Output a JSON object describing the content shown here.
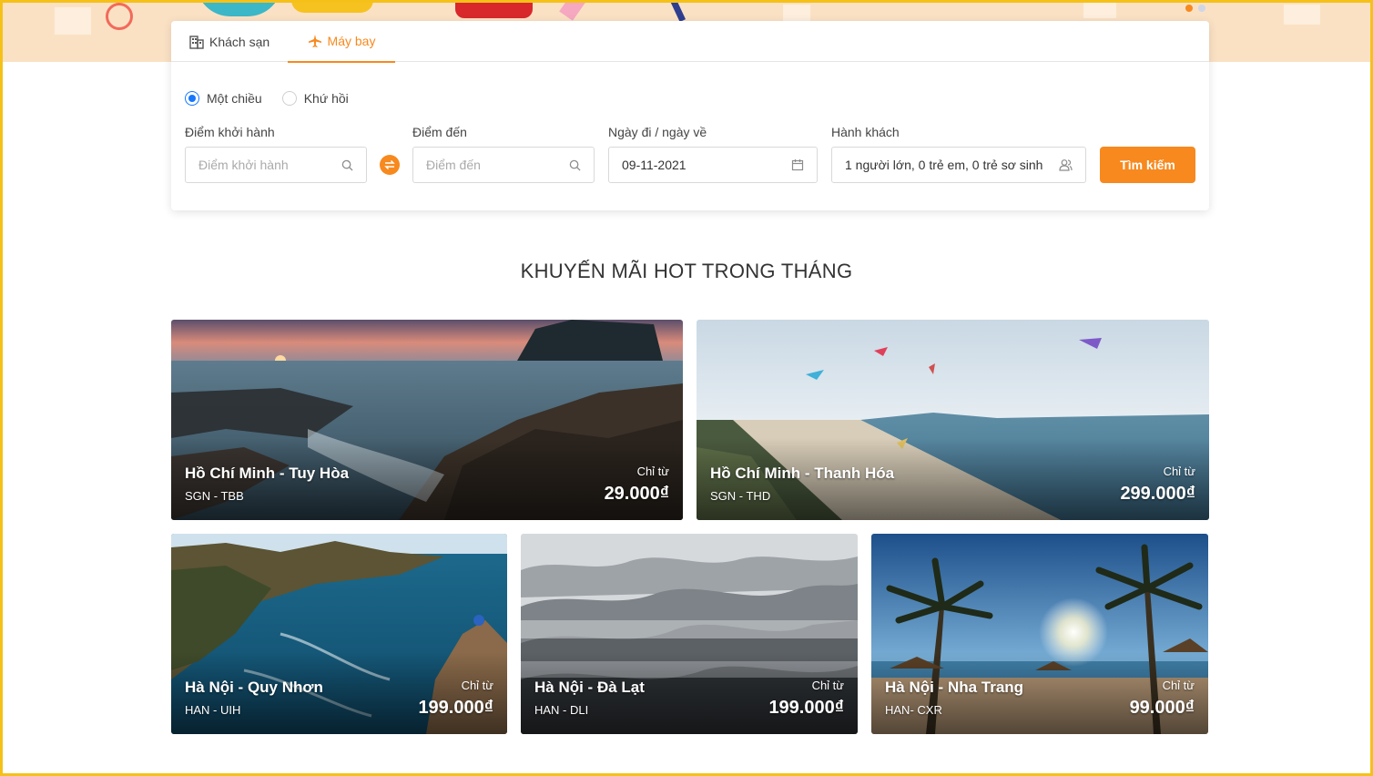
{
  "tabs": [
    {
      "label": "Khách sạn",
      "icon": "building-icon"
    },
    {
      "label": "Máy bay",
      "icon": "plane-icon",
      "active": true
    }
  ],
  "trip_type": {
    "options": [
      "Một chiều",
      "Khứ hồi"
    ],
    "selected": "Một chiều"
  },
  "search": {
    "origin": {
      "label": "Điểm khởi hành",
      "placeholder": "Điểm khởi hành",
      "value": ""
    },
    "destination": {
      "label": "Điểm đến",
      "placeholder": "Điểm đến",
      "value": ""
    },
    "dates": {
      "label": "Ngày đi / ngày về",
      "value": "09-11-2021"
    },
    "passengers": {
      "label": "Hành khách",
      "value": "1 người lớn, 0 trẻ em, 0 trẻ sơ sinh"
    },
    "button_label": "Tìm kiếm"
  },
  "promo": {
    "title": "KHUYẾN MÃI HOT TRONG THÁNG",
    "cards": [
      {
        "route": "Hồ Chí Minh - Tuy Hòa",
        "code": "SGN - TBB",
        "from_label": "Chỉ từ",
        "price": "29.000₫"
      },
      {
        "route": "Hồ Chí Minh - Thanh Hóa",
        "code": "SGN - THD",
        "from_label": "Chỉ từ",
        "price": "299.000₫"
      },
      {
        "route": "Hà Nội - Quy Nhơn",
        "code": "HAN - UIH",
        "from_label": "Chỉ từ",
        "price": "199.000₫"
      },
      {
        "route": "Hà Nội - Đà Lạt",
        "code": "HAN - DLI",
        "from_label": "Chỉ từ",
        "price": "199.000₫"
      },
      {
        "route": "Hà Nội - Nha Trang",
        "code": "HAN- CXR",
        "from_label": "Chỉ từ",
        "price": "99.000₫"
      }
    ]
  },
  "colors": {
    "accent": "#f7891e",
    "radio_selected": "#1677ff",
    "banner": "#fbe1c4",
    "frame": "#f5c118"
  }
}
